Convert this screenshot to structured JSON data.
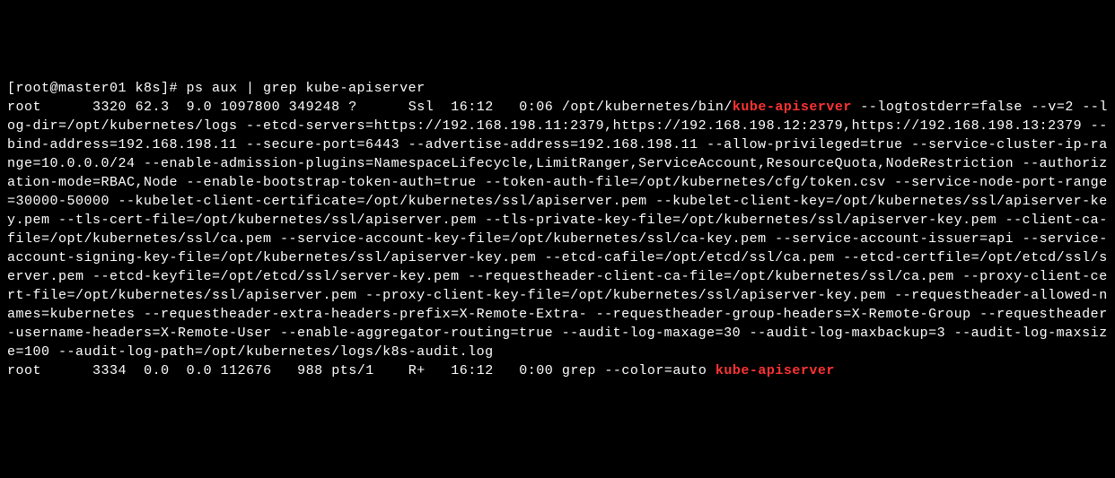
{
  "terminal": {
    "prompt": "[root@master01 k8s]# ",
    "command": "ps aux | grep kube-apiserver",
    "process1": {
      "user": "root",
      "pid": "3320",
      "cpu": "62.3",
      "mem": "9.0",
      "vsz": "1097800",
      "rss": "349248",
      "tty": "?",
      "stat": "Ssl",
      "start": "16:12",
      "time": "0:06",
      "cmd_prefix": "/opt/kubernetes/bin/",
      "highlighted": "kube-apiserver",
      "args": " --logtostderr=false --v=2 --log-dir=/opt/kubernetes/logs --etcd-servers=https://192.168.198.11:2379,https://192.168.198.12:2379,https://192.168.198.13:2379 --bind-address=192.168.198.11 --secure-port=6443 --advertise-address=192.168.198.11 --allow-privileged=true --service-cluster-ip-range=10.0.0.0/24 --enable-admission-plugins=NamespaceLifecycle,LimitRanger,ServiceAccount,ResourceQuota,NodeRestriction --authorization-mode=RBAC,Node --enable-bootstrap-token-auth=true --token-auth-file=/opt/kubernetes/cfg/token.csv --service-node-port-range=30000-50000 --kubelet-client-certificate=/opt/kubernetes/ssl/apiserver.pem --kubelet-client-key=/opt/kubernetes/ssl/apiserver-key.pem --tls-cert-file=/opt/kubernetes/ssl/apiserver.pem --tls-private-key-file=/opt/kubernetes/ssl/apiserver-key.pem --client-ca-file=/opt/kubernetes/ssl/ca.pem --service-account-key-file=/opt/kubernetes/ssl/ca-key.pem --service-account-issuer=api --service-account-signing-key-file=/opt/kubernetes/ssl/apiserver-key.pem --etcd-cafile=/opt/etcd/ssl/ca.pem --etcd-certfile=/opt/etcd/ssl/server.pem --etcd-keyfile=/opt/etcd/ssl/server-key.pem --requestheader-client-ca-file=/opt/kubernetes/ssl/ca.pem --proxy-client-cert-file=/opt/kubernetes/ssl/apiserver.pem --proxy-client-key-file=/opt/kubernetes/ssl/apiserver-key.pem --requestheader-allowed-names=kubernetes --requestheader-extra-headers-prefix=X-Remote-Extra- --requestheader-group-headers=X-Remote-Group --requestheader-username-headers=X-Remote-User --enable-aggregator-routing=true --audit-log-maxage=30 --audit-log-maxbackup=3 --audit-log-maxsize=100 --audit-log-path=/opt/kubernetes/logs/k8s-audit.log"
    },
    "process2": {
      "user": "root",
      "pid": "3334",
      "cpu": "0.0",
      "mem": "0.0",
      "vsz": "112676",
      "rss": "988",
      "tty": "pts/1",
      "stat": "R+",
      "start": "16:12",
      "time": "0:00",
      "cmd": "grep --color=auto ",
      "highlighted": "kube-apiserver"
    }
  }
}
